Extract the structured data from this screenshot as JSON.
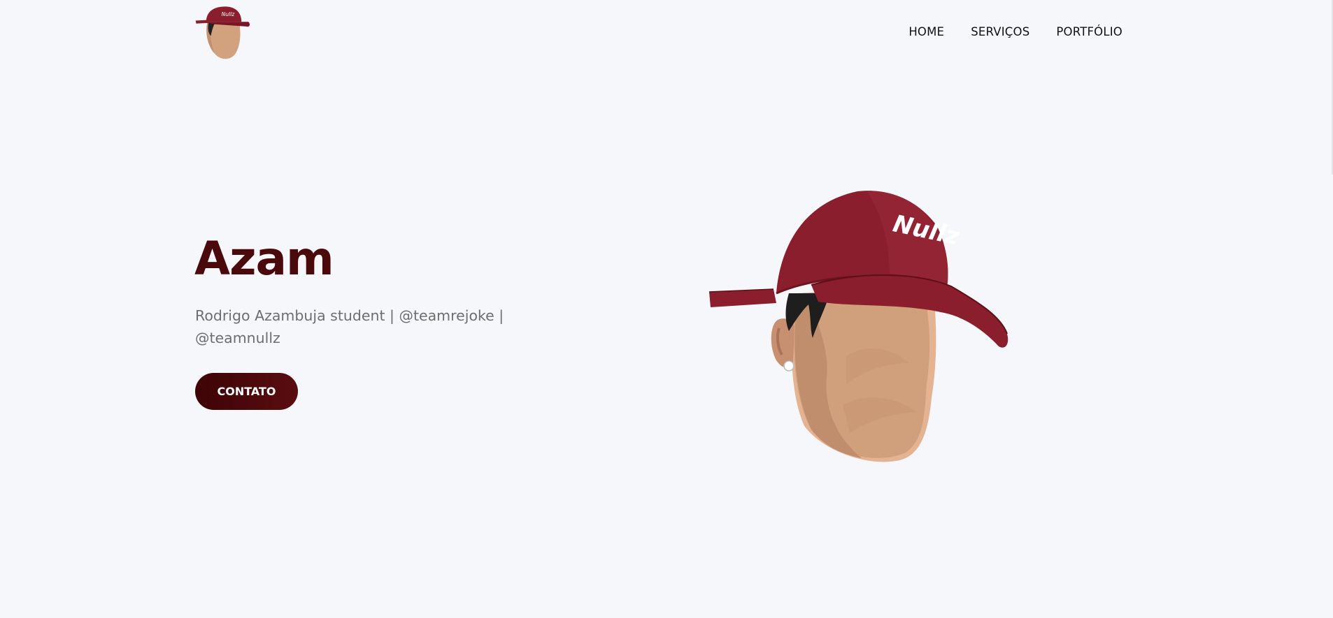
{
  "header": {
    "nav": [
      {
        "label": "HOME"
      },
      {
        "label": "SERVIÇOS"
      },
      {
        "label": "PORTFÓLIO"
      }
    ]
  },
  "hero": {
    "title": "Azam",
    "subtitle": "Rodrigo Azambuja student | @teamrejoke | @teamnullz",
    "cta_label": "CONTATO",
    "cap_text": "Nullz"
  },
  "colors": {
    "background": "#f6f7fb",
    "brand": "#4a0a0c",
    "cap": "#8b1e2d",
    "skin": "#d0a07d",
    "text_muted": "#6e6e6e"
  }
}
